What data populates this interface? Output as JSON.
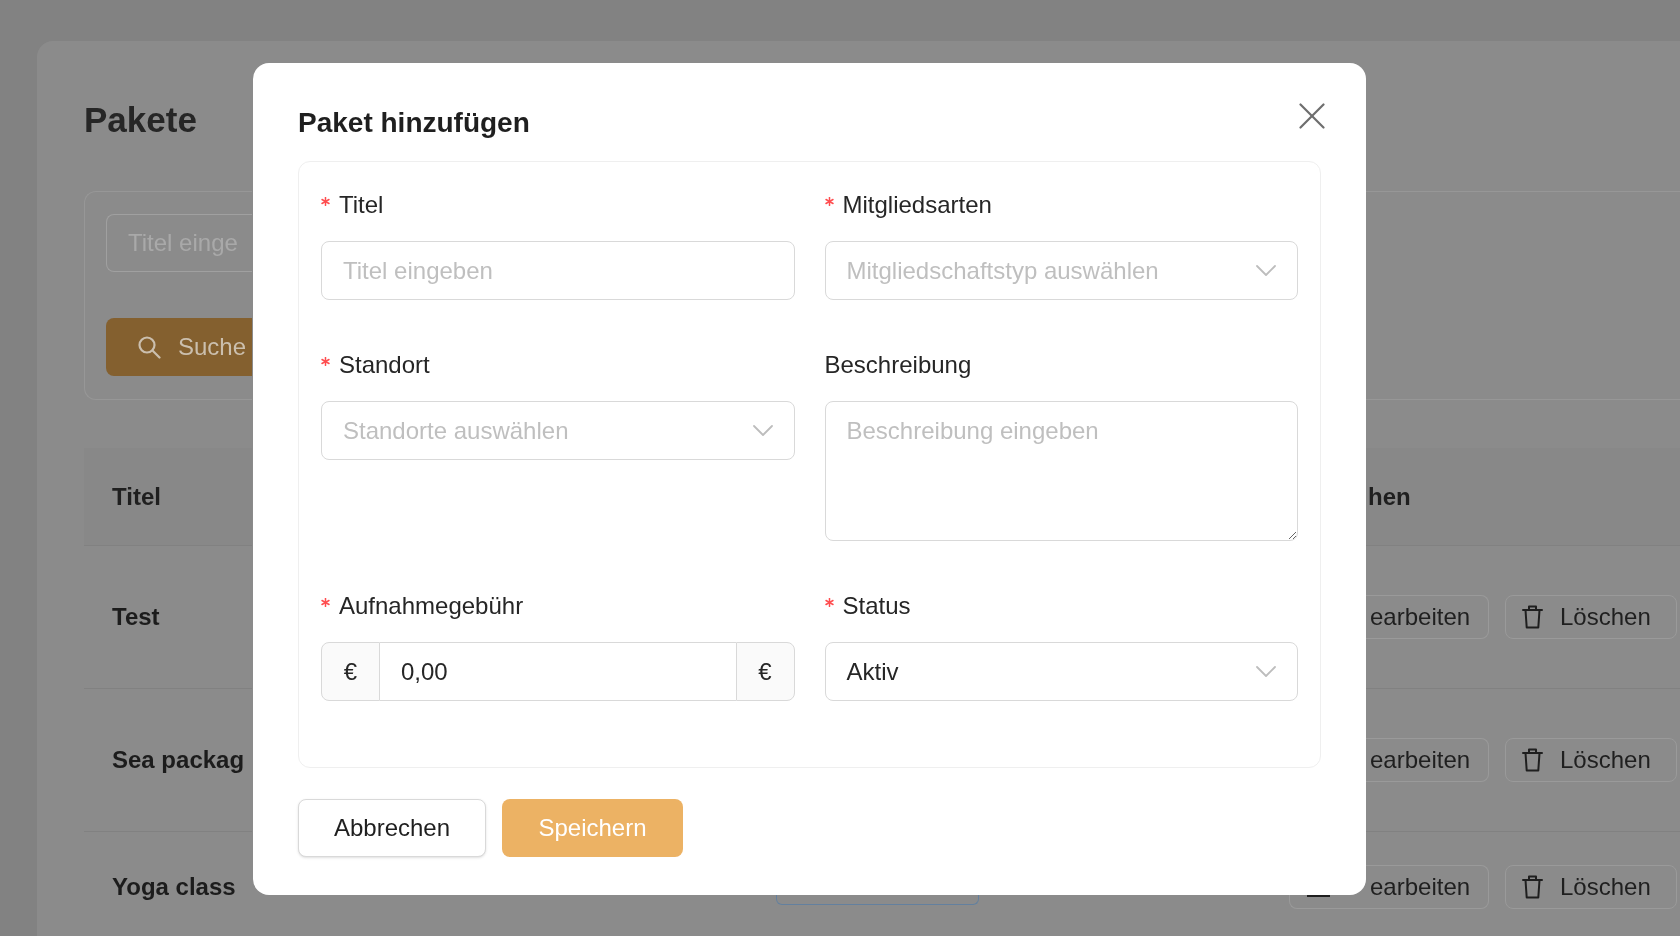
{
  "page": {
    "title": "Pakete",
    "search": {
      "placeholder": "Titel einge",
      "button": "Suche"
    },
    "table": {
      "columns": [
        "Titel",
        "hen"
      ],
      "rows": [
        {
          "title": "Test",
          "actions": [
            {
              "kind": "edit",
              "label": "earbeiten"
            },
            {
              "kind": "delete",
              "label": "Löschen"
            }
          ]
        },
        {
          "title": "Sea packag",
          "actions": [
            {
              "kind": "edit",
              "label": "earbeiten"
            },
            {
              "kind": "delete",
              "label": "Löschen"
            }
          ]
        },
        {
          "title": "Yoga class",
          "actions": [
            {
              "kind": "edit",
              "label": "earbeiten"
            },
            {
              "kind": "delete",
              "label": "Löschen"
            }
          ]
        }
      ]
    }
  },
  "dialog": {
    "title": "Paket hinzufügen",
    "fields": [
      {
        "kind": "input",
        "label": "Titel",
        "required": true,
        "placeholder": "Titel eingeben"
      },
      {
        "kind": "select",
        "label": "Mitgliedsarten",
        "required": true,
        "placeholder": "Mitgliedschaftstyp auswählen"
      },
      {
        "kind": "select",
        "label": "Standort",
        "required": true,
        "placeholder": "Standorte auswählen"
      },
      {
        "kind": "textarea",
        "label": "Beschreibung",
        "required": false,
        "placeholder": "Beschreibung eingeben"
      },
      {
        "kind": "money",
        "label": "Aufnahmegebühr",
        "required": true,
        "prefix": "€",
        "value": "0,00",
        "suffix": "€"
      },
      {
        "kind": "select",
        "label": "Status",
        "required": true,
        "value": "Aktiv"
      }
    ],
    "buttons": [
      {
        "kind": "default",
        "label": "Abbrechen"
      },
      {
        "kind": "primary",
        "label": "Speichern"
      }
    ]
  }
}
